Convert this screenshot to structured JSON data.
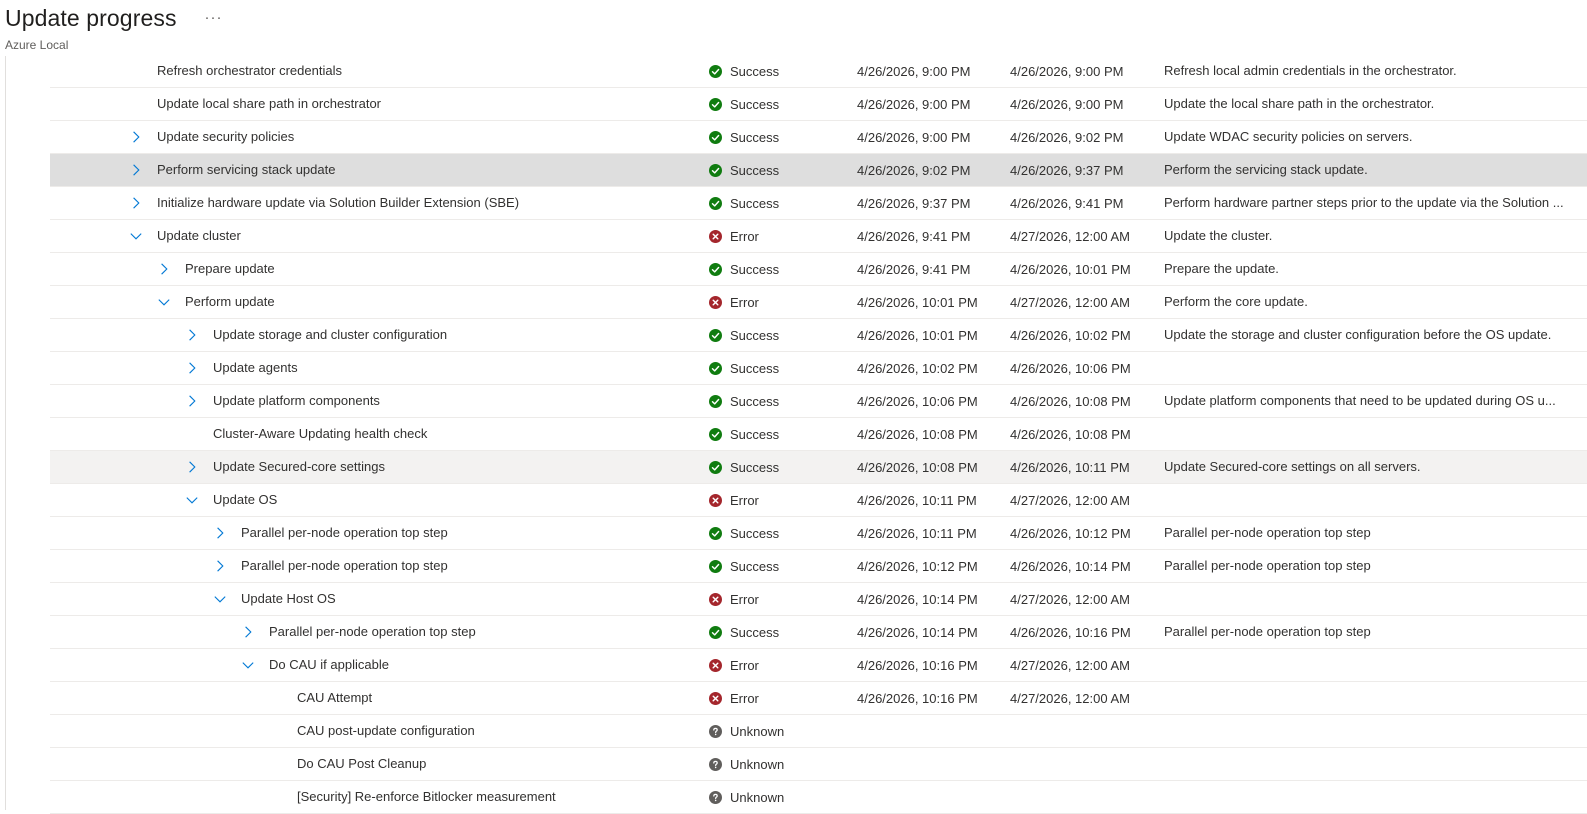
{
  "header": {
    "title": "Update progress",
    "more_label": "···",
    "subtitle": "Azure Local"
  },
  "colors": {
    "success": "#107c10",
    "error": "#a4262c",
    "unknown": "#605e5c",
    "chevron": "#0078d4"
  },
  "icons": {
    "success": "checkmark-circle-icon",
    "error": "error-circle-icon",
    "unknown": "question-circle-icon",
    "collapsed": "chevron-right-icon",
    "expanded": "chevron-down-icon"
  },
  "rows": [
    {
      "name": "Refresh orchestrator credentials",
      "level": 0,
      "toggle": "none",
      "status": "Success",
      "start": "4/26/2026, 9:00 PM",
      "end": "4/26/2026, 9:00 PM",
      "description": "Refresh local admin credentials in the orchestrator."
    },
    {
      "name": "Update local share path in orchestrator",
      "level": 0,
      "toggle": "none",
      "status": "Success",
      "start": "4/26/2026, 9:00 PM",
      "end": "4/26/2026, 9:00 PM",
      "description": "Update the local share path in the orchestrator."
    },
    {
      "name": "Update security policies",
      "level": 0,
      "toggle": "collapsed",
      "status": "Success",
      "start": "4/26/2026, 9:00 PM",
      "end": "4/26/2026, 9:02 PM",
      "description": "Update WDAC security policies on servers."
    },
    {
      "name": "Perform servicing stack update",
      "level": 0,
      "toggle": "collapsed",
      "status": "Success",
      "start": "4/26/2026, 9:02 PM",
      "end": "4/26/2026, 9:37 PM",
      "description": "Perform the servicing stack update.",
      "selected": true
    },
    {
      "name": "Initialize hardware update via Solution Builder Extension (SBE)",
      "level": 0,
      "toggle": "collapsed",
      "status": "Success",
      "start": "4/26/2026, 9:37 PM",
      "end": "4/26/2026, 9:41 PM",
      "description": "Perform hardware partner steps prior to the update via the Solution ..."
    },
    {
      "name": "Update cluster",
      "level": 0,
      "toggle": "expanded",
      "status": "Error",
      "start": "4/26/2026, 9:41 PM",
      "end": "4/27/2026, 12:00 AM",
      "description": "Update the cluster."
    },
    {
      "name": "Prepare update",
      "level": 1,
      "toggle": "collapsed",
      "status": "Success",
      "start": "4/26/2026, 9:41 PM",
      "end": "4/26/2026, 10:01 PM",
      "description": "Prepare the update."
    },
    {
      "name": "Perform update",
      "level": 1,
      "toggle": "expanded",
      "status": "Error",
      "start": "4/26/2026, 10:01 PM",
      "end": "4/27/2026, 12:00 AM",
      "description": "Perform the core update."
    },
    {
      "name": "Update storage and cluster configuration",
      "level": 2,
      "toggle": "collapsed",
      "status": "Success",
      "start": "4/26/2026, 10:01 PM",
      "end": "4/26/2026, 10:02 PM",
      "description": "Update the storage and cluster configuration before the OS update."
    },
    {
      "name": "Update agents",
      "level": 2,
      "toggle": "collapsed",
      "status": "Success",
      "start": "4/26/2026, 10:02 PM",
      "end": "4/26/2026, 10:06 PM",
      "description": ""
    },
    {
      "name": "Update platform components",
      "level": 2,
      "toggle": "collapsed",
      "status": "Success",
      "start": "4/26/2026, 10:06 PM",
      "end": "4/26/2026, 10:08 PM",
      "description": "Update platform components that need to be updated during OS u..."
    },
    {
      "name": "Cluster-Aware Updating health check",
      "level": 2,
      "toggle": "none",
      "status": "Success",
      "start": "4/26/2026, 10:08 PM",
      "end": "4/26/2026, 10:08 PM",
      "description": ""
    },
    {
      "name": "Update Secured-core settings",
      "level": 2,
      "toggle": "collapsed",
      "status": "Success",
      "start": "4/26/2026, 10:08 PM",
      "end": "4/26/2026, 10:11 PM",
      "description": "Update Secured-core settings on all servers.",
      "hovered": true
    },
    {
      "name": "Update OS",
      "level": 2,
      "toggle": "expanded",
      "status": "Error",
      "start": "4/26/2026, 10:11 PM",
      "end": "4/27/2026, 12:00 AM",
      "description": ""
    },
    {
      "name": "Parallel per-node operation top step",
      "level": 3,
      "toggle": "collapsed",
      "status": "Success",
      "start": "4/26/2026, 10:11 PM",
      "end": "4/26/2026, 10:12 PM",
      "description": "Parallel per-node operation top step"
    },
    {
      "name": "Parallel per-node operation top step",
      "level": 3,
      "toggle": "collapsed",
      "status": "Success",
      "start": "4/26/2026, 10:12 PM",
      "end": "4/26/2026, 10:14 PM",
      "description": "Parallel per-node operation top step"
    },
    {
      "name": "Update Host OS",
      "level": 3,
      "toggle": "expanded",
      "status": "Error",
      "start": "4/26/2026, 10:14 PM",
      "end": "4/27/2026, 12:00 AM",
      "description": ""
    },
    {
      "name": "Parallel per-node operation top step",
      "level": 4,
      "toggle": "collapsed",
      "status": "Success",
      "start": "4/26/2026, 10:14 PM",
      "end": "4/26/2026, 10:16 PM",
      "description": "Parallel per-node operation top step"
    },
    {
      "name": "Do CAU if applicable",
      "level": 4,
      "toggle": "expanded",
      "status": "Error",
      "start": "4/26/2026, 10:16 PM",
      "end": "4/27/2026, 12:00 AM",
      "description": ""
    },
    {
      "name": "CAU Attempt",
      "level": 5,
      "toggle": "none",
      "status": "Error",
      "start": "4/26/2026, 10:16 PM",
      "end": "4/27/2026, 12:00 AM",
      "description": ""
    },
    {
      "name": "CAU post-update configuration",
      "level": 5,
      "toggle": "none",
      "status": "Unknown",
      "start": "",
      "end": "",
      "description": ""
    },
    {
      "name": "Do CAU Post Cleanup",
      "level": 5,
      "toggle": "none",
      "status": "Unknown",
      "start": "",
      "end": "",
      "description": ""
    },
    {
      "name": "[Security] Re-enforce Bitlocker measurement",
      "level": 5,
      "toggle": "none",
      "status": "Unknown",
      "start": "",
      "end": "",
      "description": ""
    }
  ]
}
